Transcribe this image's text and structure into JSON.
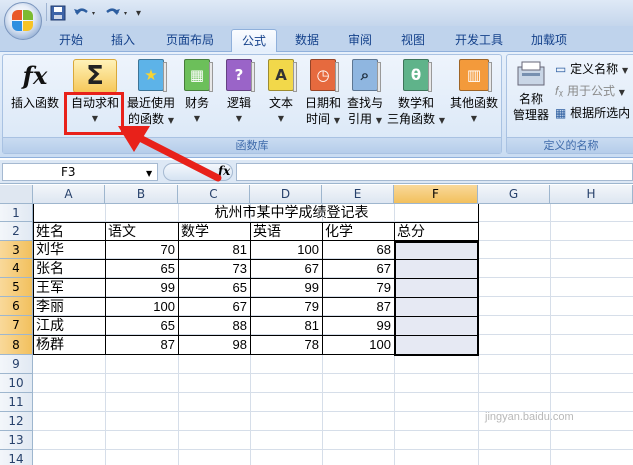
{
  "titlebar": {
    "qa_icons": [
      "save-icon",
      "undo-icon",
      "redo-icon"
    ]
  },
  "tabs": [
    {
      "label": "开始"
    },
    {
      "label": "插入"
    },
    {
      "label": "页面布局"
    },
    {
      "label": "公式"
    },
    {
      "label": "数据"
    },
    {
      "label": "审阅"
    },
    {
      "label": "视图"
    },
    {
      "label": "开发工具"
    },
    {
      "label": "加载项"
    }
  ],
  "ribbon": {
    "group_label": "函数库",
    "insert_function": {
      "line1": "插入函数",
      "icon": "fx-icon"
    },
    "autosum": {
      "line1": "自动求和",
      "icon": "sigma-icon"
    },
    "recent": {
      "line1": "最近使用",
      "line2": "的函数"
    },
    "finance": {
      "line1": "财务"
    },
    "logic": {
      "line1": "逻辑"
    },
    "text": {
      "line1": "文本"
    },
    "datetime": {
      "line1": "日期和",
      "line2": "时间"
    },
    "lookup": {
      "line1": "查找与",
      "line2": "引用"
    },
    "math": {
      "line1": "数学和",
      "line2": "三角函数"
    },
    "more": {
      "line1": "其他函数"
    },
    "names_group_label": "定义的名称",
    "name_manager": {
      "line1": "名称",
      "line2": "管理器"
    },
    "define_name": "定义名称",
    "use_in_formula": "用于公式",
    "create_from_selection": "根据所选内"
  },
  "formula_bar": {
    "cell_ref": "F3",
    "fx_label": "fx",
    "value": ""
  },
  "sheet": {
    "columns": [
      "A",
      "B",
      "C",
      "D",
      "E",
      "F",
      "G",
      "H"
    ],
    "rows": [
      "1",
      "2",
      "3",
      "4",
      "5",
      "6",
      "7",
      "8",
      "9",
      "10",
      "11",
      "12",
      "13",
      "14"
    ],
    "title": "杭州市某中学成绩登记表",
    "headers": [
      "姓名",
      "语文",
      "数学",
      "英语",
      "化学",
      "总分"
    ],
    "records": [
      {
        "name": "刘华",
        "chinese": "70",
        "math": "81",
        "english": "100",
        "chem": "68"
      },
      {
        "name": "张名",
        "chinese": "65",
        "math": "73",
        "english": "67",
        "chem": "67"
      },
      {
        "name": "王军",
        "chinese": "99",
        "math": "65",
        "english": "99",
        "chem": "79"
      },
      {
        "name": "李丽",
        "chinese": "100",
        "math": "67",
        "english": "79",
        "chem": "87"
      },
      {
        "name": "江成",
        "chinese": "65",
        "math": "88",
        "english": "81",
        "chem": "99"
      },
      {
        "name": "杨群",
        "chinese": "87",
        "math": "98",
        "english": "78",
        "chem": "100"
      }
    ],
    "selected_range": "F3:F8"
  },
  "colors": {
    "highlight_red": "#e8211a",
    "selection_fill": "#e6e9f3"
  },
  "watermark": "jingyan.baidu.com"
}
